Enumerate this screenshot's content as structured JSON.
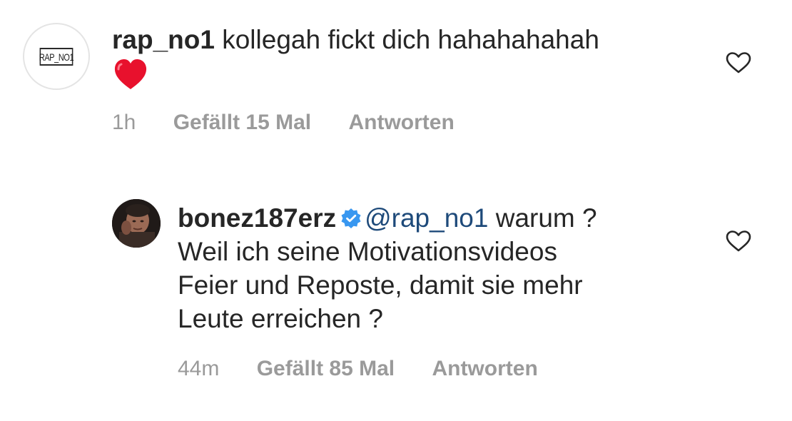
{
  "comments": [
    {
      "username": "rap_no1",
      "text": "kollegah fickt dich hahahahahah",
      "emoji": "red-heart",
      "avatar_logo_text": "RAP_NO1",
      "time": "1h",
      "likes": "Gefällt 15 Mal",
      "reply": "Antworten"
    },
    {
      "username": "bonez187erz",
      "verified": true,
      "mention": "@rap_no1",
      "text_line1_rest": "warum ?",
      "text_line2": "Weil ich seine Motivationsvideos",
      "text_line3": "Feier und Reposte, damit sie mehr",
      "text_line4": "Leute erreichen ?",
      "time": "44m",
      "likes": "Gefällt 85 Mal",
      "reply": "Antworten"
    }
  ],
  "icons": {
    "like": "heart-outline-icon",
    "verified": "verified-badge-icon",
    "emoji": "red-heart-emoji"
  },
  "colors": {
    "text": "#262626",
    "meta": "#9a9a9a",
    "mention": "#1e4a7a",
    "verified": "#3897f0",
    "heart_emoji": "#e8112d"
  }
}
